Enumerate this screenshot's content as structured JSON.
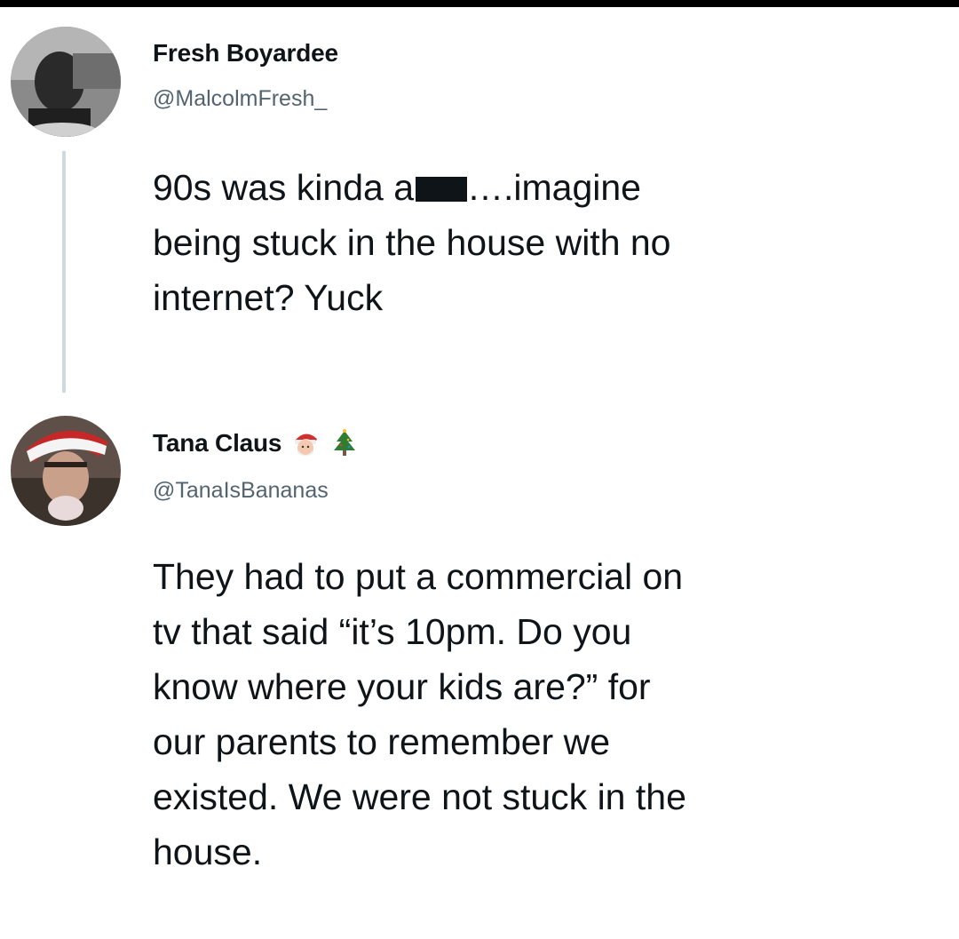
{
  "tweets": [
    {
      "display_name": "Fresh Boyardee",
      "handle": "@MalcolmFresh_",
      "text_before_redaction": "90s was kinda a",
      "text_after_redaction": "….imagine\nbeing stuck in the house with no\ninternet? Yuck"
    },
    {
      "display_name": "Tana Claus",
      "handle": "@TanaIsBananas",
      "name_emojis": [
        "santa-face-icon",
        "christmas-tree-icon"
      ],
      "text": "They had to put a commercial on\ntv that said “it’s 10pm. Do you\nknow where your kids are?” for\nour parents to remember we\nexisted. We were not stuck in the\nhouse."
    }
  ]
}
